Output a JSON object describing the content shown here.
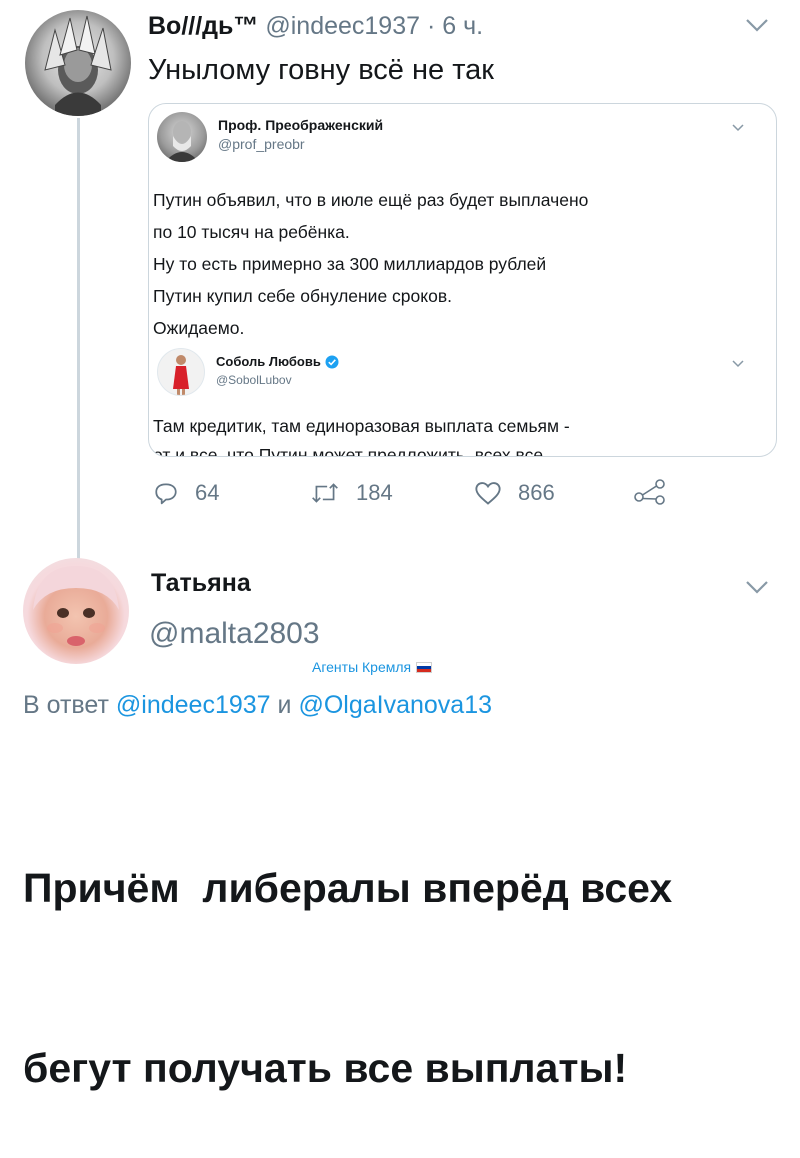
{
  "tweet1": {
    "author_name": "Во///дь™",
    "handle": "@indeec1937",
    "separator": "·",
    "time": "6 ч.",
    "text": "Унылому говну всё не так",
    "quoted": {
      "author_name": "Проф. Преображенский",
      "handle": "@prof_preobr",
      "lines": [
        "Путин объявил, что в июле ещё раз будет выплачено",
        "по 10 тысяч на ребёнка.",
        "Ну то есть примерно за 300 миллиардов рублей",
        "Путин купил себе обнуление сроков.",
        "Ожидаемо."
      ],
      "nested": {
        "author_name": "Соболь Любовь",
        "handle": "@SobolLubov",
        "text": "Там кредитик, там единоразовая выплата семьям -",
        "text_cut": "от и все, что Путин может предложить, всех все"
      }
    },
    "actions": {
      "replies": "64",
      "retweets": "184",
      "likes": "866"
    }
  },
  "tweet2": {
    "author_name": "Татьяна",
    "handle": "@malta2803",
    "badge_text": "Агенты Кремля",
    "reply_prefix": "В ответ",
    "reply_user1": "@indeec1937",
    "reply_and": "и",
    "reply_user2": "@OlgaIvanova13",
    "text_line1": "Причём  либералы вперёд всех",
    "text_line2": "бегут получать все выплаты!"
  },
  "colors": {
    "link": "#1b95e0",
    "muted": "#657786",
    "verified": "#1da1f2",
    "flag_white": "#ffffff",
    "flag_blue": "#0039a6",
    "flag_red": "#d52b1e"
  }
}
